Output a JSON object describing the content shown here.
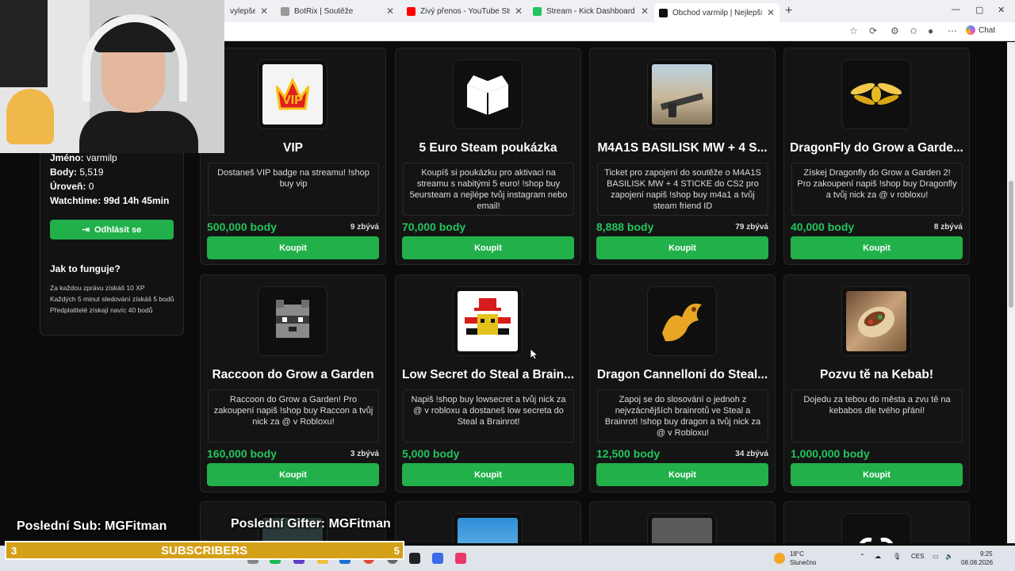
{
  "browser": {
    "tabs": [
      {
        "title": "vylepšení s...",
        "color": "#ffffff"
      },
      {
        "title": "BotRix | Soutěže",
        "color": "#9a9a9a"
      },
      {
        "title": "Živý přenos - YouTube Studio",
        "color": "#ff0000"
      },
      {
        "title": "Stream - Kick Dashboard",
        "color": "#22c55e"
      },
      {
        "title": "Obchod varmilp | Nejlepší software",
        "color": "#111111"
      }
    ],
    "new_tab": "+",
    "chat_label": "Chat"
  },
  "user": {
    "name_label": "Jméno:",
    "name_value": "varmilp",
    "points_label": "Body:",
    "points_value": "5,519",
    "level_label": "Úroveň:",
    "level_value": "0",
    "watchtime_label": "Watchtime:",
    "watchtime_value": "99d 14h 45min",
    "logout_label": "Odhlásit se"
  },
  "how": {
    "title": "Jak to funguje?",
    "lines": [
      "Za každou zprávu získáš 10 XP",
      "Každých 5 minut sledování získáš 5 bodů",
      "Předplatitelé získají navíc 40 bodů"
    ]
  },
  "products": [
    {
      "name": "VIP",
      "desc": "Dostaneš VIP badge na streamu! !shop buy vip",
      "price": "500,000 body",
      "left": "9 zbývá",
      "buy": "Koupit",
      "icon": "vip-crown-icon"
    },
    {
      "name": "5 Euro Steam poukázka",
      "desc": "Koupíš si poukázku pro aktivaci na streamu s nabitými 5 euro! !shop buy 5eursteam a nejlépe tvůj instagram nebo email!",
      "price": "70,000 body",
      "left": "",
      "buy": "Koupit",
      "icon": "box-icon"
    },
    {
      "name": "M4A1S BASILISK MW + 4 S...",
      "desc": "Ticket pro zapojení do soutěže o M4A1S BASILISK MW + 4 STICKE do CS2 pro zapojení napiš !shop buy m4a1 a tvůj steam friend ID",
      "price": "8,888 body",
      "left": "79 zbývá",
      "buy": "Koupit",
      "icon": "rifle-icon"
    },
    {
      "name": "DragonFly do Grow a Garde...",
      "desc": "Získej Dragonfly do Grow a Garden 2! Pro zakoupení napiš !shop buy Dragonfly a tvůj nick za @ v robloxu!",
      "price": "40,000 body",
      "left": "8 zbývá",
      "buy": "Koupit",
      "icon": "dragonfly-icon"
    },
    {
      "name": "Raccoon do Grow a Garden",
      "desc": "Raccoon do Grow a Garden! Pro zakoupení napiš !shop buy Raccon a tvůj nick za @ v Robloxu!",
      "price": "160,000 body",
      "left": "3 zbývá",
      "buy": "Koupit",
      "icon": "raccoon-icon"
    },
    {
      "name": "Low Secret do Steal a Brain...",
      "desc": "Napiš !shop buy lowsecret a tvůj nick za @ v robloxu a dostaneš low secreta do Steal a Brainrot!",
      "price": "5,000 body",
      "left": "",
      "buy": "Koupit",
      "icon": "spider-icon"
    },
    {
      "name": "Dragon Cannelloni do Steal...",
      "desc": "Zapoj se do slosování o jednoh z nejvzácnějších brainrotů ve Steal a Brainrot! !shop buy dragon a tvůj nick za @ v Robloxu!",
      "price": "12,500 body",
      "left": "34 zbývá",
      "buy": "Koupit",
      "icon": "dragon-icon"
    },
    {
      "name": "Pozvu tě na Kebab!",
      "desc": "Dojedu za tebou do města a zvu tě na kebabos dle tvého přání!",
      "price": "1,000,000 body",
      "left": "",
      "buy": "Koupit",
      "icon": "kebab-icon"
    }
  ],
  "overlay": {
    "last_sub": "Poslední Sub: MGFitman",
    "last_gifter": "Poslední Gifter: MGFitman",
    "sub_count_left": "3",
    "sub_label": "SUBSCRIBERS",
    "sub_count_right": "5"
  },
  "taskbar": {
    "weather_temp": "18°C",
    "weather_desc": "Slunečno",
    "lang": "CES",
    "time": "9:25",
    "date": "08.08.2026"
  },
  "colors": {
    "accent": "#22b04b",
    "price": "#22c55e",
    "sub_bar": "#d4a017"
  }
}
